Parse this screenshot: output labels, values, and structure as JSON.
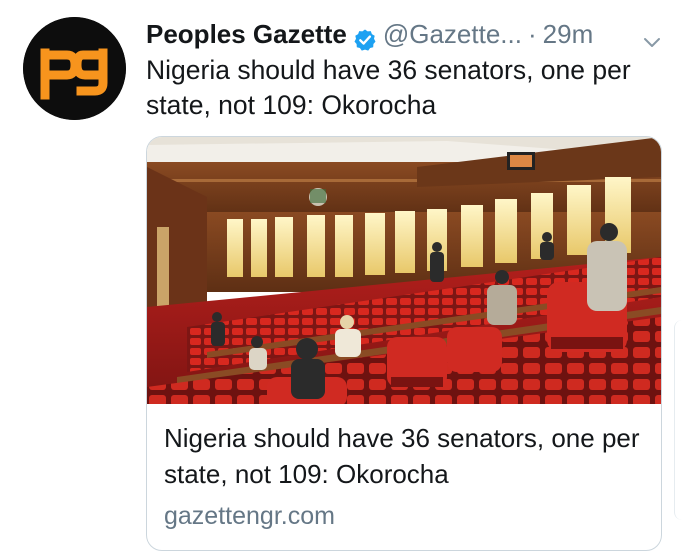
{
  "author": {
    "name": "Peoples Gazette",
    "handle": "@Gazette...",
    "separator": "·",
    "time": "29m",
    "verified": true,
    "avatar_icon": "peoples-gazette-logo",
    "avatar_text": "pg"
  },
  "tweet": {
    "text": "Nigeria should have 36 senators, one per state, not 109: Okorocha"
  },
  "card": {
    "image_alt": "Nigerian Senate chamber with red seats",
    "title": "Nigeria should have 36 senators, one per state, not 109: Okorocha",
    "domain": "gazettengr.com"
  },
  "colors": {
    "text": "#14171a",
    "secondary": "#657786",
    "verified_badge": "#1da1f2",
    "logo_orange": "#f7941d",
    "avatar_bg": "#0d0d0d",
    "seat_red": "#c8231f"
  },
  "icons": {
    "verified": "verified-badge-icon",
    "caret": "chevron-down-icon"
  }
}
